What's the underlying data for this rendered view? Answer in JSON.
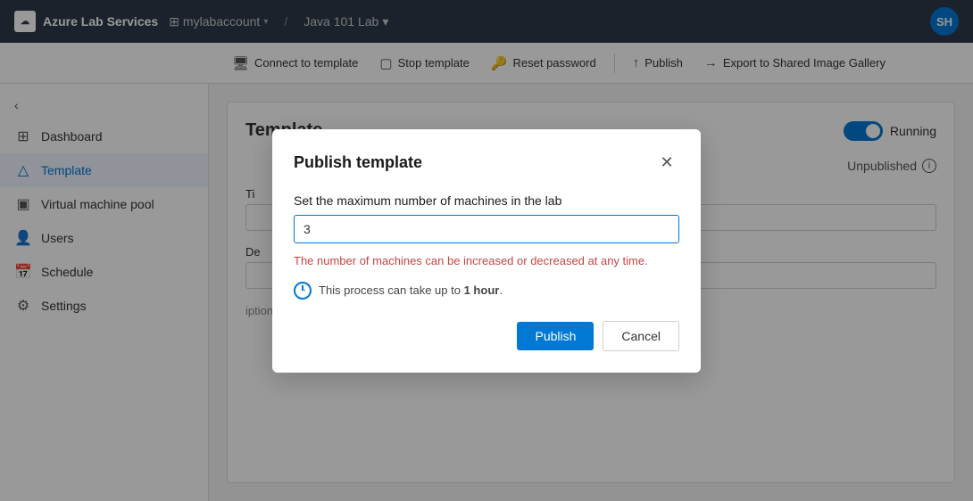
{
  "topbar": {
    "logo_text": "Azure",
    "logo_suffix": " Lab Services",
    "account_name": "mylabaccount",
    "lab_name": "Java 101 Lab",
    "user_initials": "SH"
  },
  "toolbar": {
    "connect_label": "Connect to template",
    "stop_label": "Stop template",
    "reset_label": "Reset password",
    "publish_label": "Publish",
    "export_label": "Export to Shared Image Gallery"
  },
  "sidebar": {
    "collapse_icon": "‹",
    "items": [
      {
        "label": "Dashboard",
        "icon": "⊞"
      },
      {
        "label": "Template",
        "icon": "△"
      },
      {
        "label": "Virtual machine pool",
        "icon": "▣"
      },
      {
        "label": "Users",
        "icon": "👤"
      },
      {
        "label": "Schedule",
        "icon": "📅"
      },
      {
        "label": "Settings",
        "icon": "⚙"
      }
    ]
  },
  "content": {
    "title": "Template",
    "running_label": "Running",
    "unpublished_label": "Unpublished",
    "title_field_label": "Ti",
    "desc_field_label": "De",
    "desc_note": "iption will be visible to students."
  },
  "modal": {
    "title": "Publish template",
    "field_label": "Set the maximum number of machines in the lab",
    "field_value": "3",
    "hint_text": "The number of machines can be increased or decreased at any time.",
    "process_text_pre": "This process can take up to ",
    "process_text_bold": "1 hour",
    "process_text_post": ".",
    "publish_btn": "Publish",
    "cancel_btn": "Cancel"
  }
}
